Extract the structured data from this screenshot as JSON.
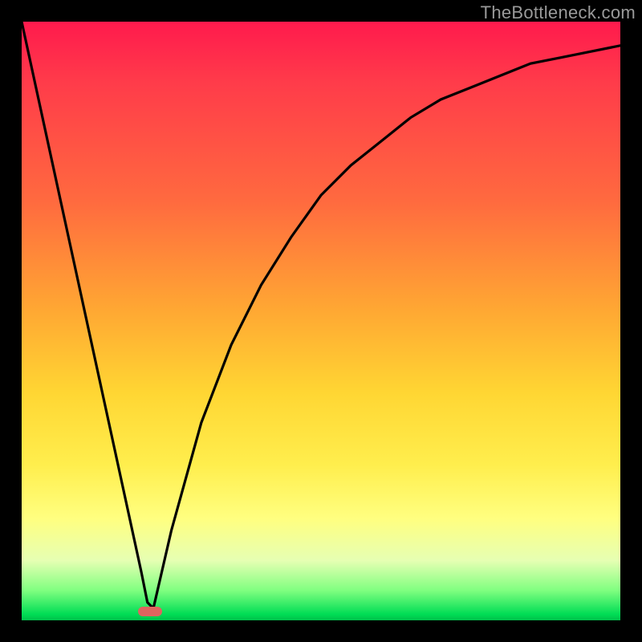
{
  "watermark": "TheBottleneck.com",
  "chart_data": {
    "type": "line",
    "title": "",
    "xlabel": "",
    "ylabel": "",
    "xlim": [
      0,
      100
    ],
    "ylim": [
      0,
      100
    ],
    "grid": false,
    "x": [
      0,
      5,
      10,
      15,
      20,
      21,
      22,
      25,
      30,
      35,
      40,
      45,
      50,
      55,
      60,
      65,
      70,
      75,
      80,
      85,
      90,
      95,
      100
    ],
    "y": [
      100,
      77,
      54,
      31,
      8,
      3,
      2,
      15,
      33,
      46,
      56,
      64,
      71,
      76,
      80,
      84,
      87,
      89,
      91,
      93,
      94,
      95,
      96
    ],
    "marker": {
      "x": 21.5,
      "y": 1.5
    },
    "colors": {
      "curve": "#000000",
      "marker": "#e0645f",
      "gradient_top": "#ff1a4d",
      "gradient_mid": "#ffd633",
      "gradient_bottom": "#00c04a"
    }
  }
}
